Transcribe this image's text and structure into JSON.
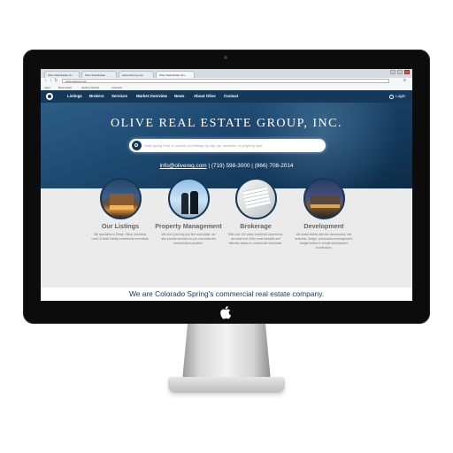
{
  "browser": {
    "tabs": [
      {
        "label": "Olive Real Estate Gr...",
        "active": false
      },
      {
        "label": "Olive Real Estate",
        "active": false
      },
      {
        "label": "www.olivereg.com",
        "active": false
      },
      {
        "label": "Olive Real Estate Gro...",
        "active": true
      }
    ],
    "url": "www.olivereg.com",
    "bookmarks": [
      "Apps",
      "Bookmarks",
      "Getting Started",
      "Imported"
    ]
  },
  "nav": {
    "items": [
      "Listings",
      "Brokers",
      "Services",
      "Market Overview",
      "News",
      "About Olive",
      "Contact"
    ],
    "login": "Login"
  },
  "hero": {
    "title": "OLIVE REAL ESTATE GROUP, INC.",
    "search_placeholder": "Start typing here or search our listings by city, zip, address, or property type.",
    "email": "info@olivereg.com",
    "phone1": "(719) 598-3000",
    "phone2": "(866) 708-2014"
  },
  "services": [
    {
      "title": "Our Listings",
      "desc": "We specialize in Retail, Office, Industrial, Land, & Multi-Family commercial real estate."
    },
    {
      "title": "Property Management",
      "desc": "We don't just help you find real estate, we also provide services so you can make the best decision possible."
    },
    {
      "title": "Brokerage",
      "desc": "With over 100 years combined experience, we have one of the most versatile and effective teams in commercial real estate."
    },
    {
      "title": "Development",
      "desc": "We assist clients with site assessment, site selection, design, construction management, budget review & overall development coordination."
    }
  ],
  "tagline": "We are Colorado Spring's commercial real estate company.",
  "colors": {
    "brand_navy": "#16395a",
    "hero_blue": "#1e4a71",
    "services_bg": "#ebebeb"
  }
}
